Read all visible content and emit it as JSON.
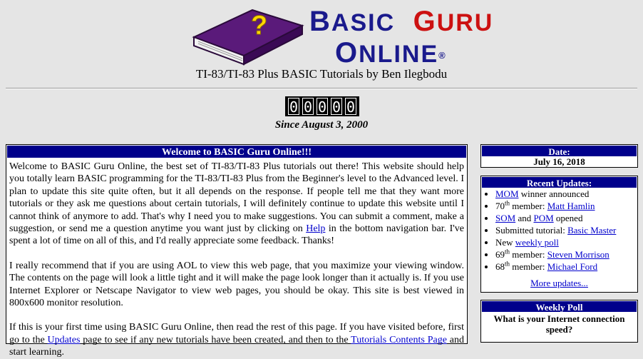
{
  "header": {
    "logo_line1_a_big": "B",
    "logo_line1_a_rest": "ASIC",
    "logo_line1_b_big": "G",
    "logo_line1_b_rest": "URU",
    "logo_line2_big": "O",
    "logo_line2_rest": "NLINE",
    "registered_mark": "®",
    "book_glyph": "?",
    "subtitle": "TI-83/TI-83 Plus BASIC Tutorials by Ben Ilegbodu",
    "counter_digits": [
      "0",
      "0",
      "0",
      "0",
      "0"
    ],
    "since": "Since August 3, 2000"
  },
  "main": {
    "heading": "Welcome to BASIC Guru Online!!!",
    "p1_a": "Welcome to BASIC Guru Online, the best set of TI-83/TI-83 Plus tutorials out there! This website should help you totally learn BASIC programming for the TI-83/TI-83 Plus from the Beginner's level to the Advanced level. I plan to update this site quite often, but it all depends on the response. If people tell me that they want more tutorials or they ask me questions about certain tutorials, I will definitely continue to update this website until I cannot think of anymore to add. That's why I need you to make suggestions. You can submit a comment, make a suggestion, or send me a question anytime you want just by clicking on ",
    "p1_link": "Help",
    "p1_b": " in the bottom navigation bar. I've spent a lot of time on all of this, and I'd really appreciate some feedback. Thanks!",
    "p2": "I really recommend that if you are using AOL to view this web page, that you maximize your viewing window. The contents on the page will look a little tight and it will make the page look longer than it actually is. If you use Internet Explorer or Netscape Navigator to view web pages, you should be okay. This site is best viewed in 800x600 monitor resolution.",
    "p3_a": "If this is your first time using BASIC Guru Online, then read the rest of this page. If you have visited before, first go to the ",
    "p3_link1": "Updates",
    "p3_b": " page to see if any new tutorials have been created, and then to the ",
    "p3_link2": "Tutorials Contents Page",
    "p3_c": " and start learning."
  },
  "sidebar": {
    "date_heading": "Date:",
    "date_value": "July 16, 2018",
    "updates_heading": "Recent Updates:",
    "updates": {
      "u1_link": "MOM",
      "u1_text": " winner announced",
      "u2_num": "70",
      "u2_sup": "th",
      "u2_text": " member: ",
      "u2_link": "Matt Hamlin",
      "u3_link1": "SOM",
      "u3_and": " and ",
      "u3_link2": "POM",
      "u3_text": " opened",
      "u4_text": "Submitted tutorial: ",
      "u4_link": "Basic Master",
      "u5_text": "New ",
      "u5_link": "weekly poll",
      "u6_num": "69",
      "u6_sup": "th",
      "u6_text": " member: ",
      "u6_link": "Steven Morrison",
      "u7_num": "68",
      "u7_sup": "th",
      "u7_text": " member: ",
      "u7_link": "Michael Ford"
    },
    "more_updates": "More updates...",
    "poll_heading": "Weekly Poll",
    "poll_question": "What is your Internet connection speed?"
  },
  "colors": {
    "panel_header": "#00008b",
    "logo_blue": "#1a1a8c",
    "logo_red": "#cc1111",
    "book_purple": "#5a1a7a",
    "link": "#0000cc",
    "background": "#e5e5e5"
  }
}
